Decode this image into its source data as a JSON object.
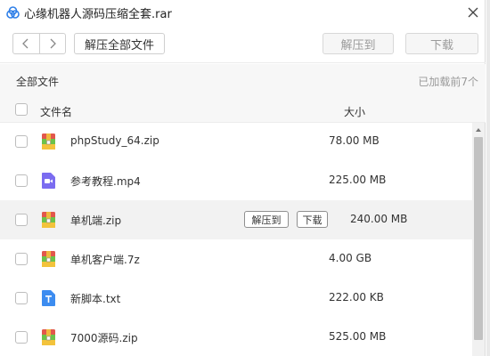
{
  "window": {
    "title": "心缘机器人源码压缩全套.rar"
  },
  "toolbar": {
    "back_icon": "chevron-left-icon",
    "forward_icon": "chevron-right-icon",
    "extract_all_label": "解压全部文件",
    "extract_to_label": "解压到",
    "download_label": "下载"
  },
  "summary": {
    "all_files_label": "全部文件",
    "loaded_label": "已加载前7个"
  },
  "table": {
    "columns": [
      "文件名",
      "大小"
    ]
  },
  "files": [
    {
      "name": "phpStudy_64.zip",
      "size": "78.00 MB",
      "icon": "archive-icon"
    },
    {
      "name": "参考教程.mp4",
      "size": "225.00 MB",
      "icon": "video-icon"
    },
    {
      "name": "单机端.zip",
      "size": "240.00 MB",
      "icon": "archive-icon"
    },
    {
      "name": "单机客户端.7z",
      "size": "4.00 GB",
      "icon": "archive-icon"
    },
    {
      "name": "新脚本.txt",
      "size": "222.00 KB",
      "icon": "text-file-icon"
    },
    {
      "name": "7000源码.zip",
      "size": "525.00 MB",
      "icon": "archive-icon"
    }
  ],
  "row_actions": {
    "extract_to_label": "解压到",
    "download_label": "下载"
  },
  "colors": {
    "archive_red": "#e2574c",
    "archive_green": "#6cc24a",
    "archive_yellow": "#f3c33c",
    "video_purple": "#7b6cf0",
    "text_blue": "#3c8cf0",
    "app_icon_blue": "#2f7fe8"
  }
}
